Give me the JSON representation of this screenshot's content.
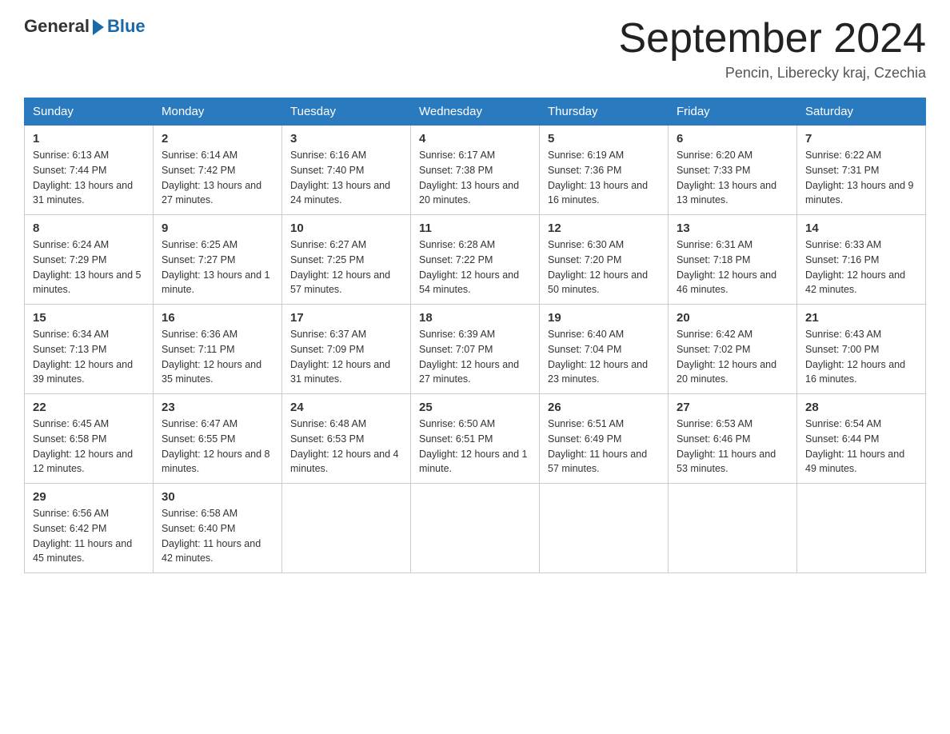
{
  "logo": {
    "text_general": "General",
    "text_blue": "Blue"
  },
  "title": "September 2024",
  "location": "Pencin, Liberecky kraj, Czechia",
  "days_of_week": [
    "Sunday",
    "Monday",
    "Tuesday",
    "Wednesday",
    "Thursday",
    "Friday",
    "Saturday"
  ],
  "weeks": [
    [
      {
        "day": "1",
        "info": "Sunrise: 6:13 AM\nSunset: 7:44 PM\nDaylight: 13 hours and 31 minutes."
      },
      {
        "day": "2",
        "info": "Sunrise: 6:14 AM\nSunset: 7:42 PM\nDaylight: 13 hours and 27 minutes."
      },
      {
        "day": "3",
        "info": "Sunrise: 6:16 AM\nSunset: 7:40 PM\nDaylight: 13 hours and 24 minutes."
      },
      {
        "day": "4",
        "info": "Sunrise: 6:17 AM\nSunset: 7:38 PM\nDaylight: 13 hours and 20 minutes."
      },
      {
        "day": "5",
        "info": "Sunrise: 6:19 AM\nSunset: 7:36 PM\nDaylight: 13 hours and 16 minutes."
      },
      {
        "day": "6",
        "info": "Sunrise: 6:20 AM\nSunset: 7:33 PM\nDaylight: 13 hours and 13 minutes."
      },
      {
        "day": "7",
        "info": "Sunrise: 6:22 AM\nSunset: 7:31 PM\nDaylight: 13 hours and 9 minutes."
      }
    ],
    [
      {
        "day": "8",
        "info": "Sunrise: 6:24 AM\nSunset: 7:29 PM\nDaylight: 13 hours and 5 minutes."
      },
      {
        "day": "9",
        "info": "Sunrise: 6:25 AM\nSunset: 7:27 PM\nDaylight: 13 hours and 1 minute."
      },
      {
        "day": "10",
        "info": "Sunrise: 6:27 AM\nSunset: 7:25 PM\nDaylight: 12 hours and 57 minutes."
      },
      {
        "day": "11",
        "info": "Sunrise: 6:28 AM\nSunset: 7:22 PM\nDaylight: 12 hours and 54 minutes."
      },
      {
        "day": "12",
        "info": "Sunrise: 6:30 AM\nSunset: 7:20 PM\nDaylight: 12 hours and 50 minutes."
      },
      {
        "day": "13",
        "info": "Sunrise: 6:31 AM\nSunset: 7:18 PM\nDaylight: 12 hours and 46 minutes."
      },
      {
        "day": "14",
        "info": "Sunrise: 6:33 AM\nSunset: 7:16 PM\nDaylight: 12 hours and 42 minutes."
      }
    ],
    [
      {
        "day": "15",
        "info": "Sunrise: 6:34 AM\nSunset: 7:13 PM\nDaylight: 12 hours and 39 minutes."
      },
      {
        "day": "16",
        "info": "Sunrise: 6:36 AM\nSunset: 7:11 PM\nDaylight: 12 hours and 35 minutes."
      },
      {
        "day": "17",
        "info": "Sunrise: 6:37 AM\nSunset: 7:09 PM\nDaylight: 12 hours and 31 minutes."
      },
      {
        "day": "18",
        "info": "Sunrise: 6:39 AM\nSunset: 7:07 PM\nDaylight: 12 hours and 27 minutes."
      },
      {
        "day": "19",
        "info": "Sunrise: 6:40 AM\nSunset: 7:04 PM\nDaylight: 12 hours and 23 minutes."
      },
      {
        "day": "20",
        "info": "Sunrise: 6:42 AM\nSunset: 7:02 PM\nDaylight: 12 hours and 20 minutes."
      },
      {
        "day": "21",
        "info": "Sunrise: 6:43 AM\nSunset: 7:00 PM\nDaylight: 12 hours and 16 minutes."
      }
    ],
    [
      {
        "day": "22",
        "info": "Sunrise: 6:45 AM\nSunset: 6:58 PM\nDaylight: 12 hours and 12 minutes."
      },
      {
        "day": "23",
        "info": "Sunrise: 6:47 AM\nSunset: 6:55 PM\nDaylight: 12 hours and 8 minutes."
      },
      {
        "day": "24",
        "info": "Sunrise: 6:48 AM\nSunset: 6:53 PM\nDaylight: 12 hours and 4 minutes."
      },
      {
        "day": "25",
        "info": "Sunrise: 6:50 AM\nSunset: 6:51 PM\nDaylight: 12 hours and 1 minute."
      },
      {
        "day": "26",
        "info": "Sunrise: 6:51 AM\nSunset: 6:49 PM\nDaylight: 11 hours and 57 minutes."
      },
      {
        "day": "27",
        "info": "Sunrise: 6:53 AM\nSunset: 6:46 PM\nDaylight: 11 hours and 53 minutes."
      },
      {
        "day": "28",
        "info": "Sunrise: 6:54 AM\nSunset: 6:44 PM\nDaylight: 11 hours and 49 minutes."
      }
    ],
    [
      {
        "day": "29",
        "info": "Sunrise: 6:56 AM\nSunset: 6:42 PM\nDaylight: 11 hours and 45 minutes."
      },
      {
        "day": "30",
        "info": "Sunrise: 6:58 AM\nSunset: 6:40 PM\nDaylight: 11 hours and 42 minutes."
      },
      {
        "day": "",
        "info": ""
      },
      {
        "day": "",
        "info": ""
      },
      {
        "day": "",
        "info": ""
      },
      {
        "day": "",
        "info": ""
      },
      {
        "day": "",
        "info": ""
      }
    ]
  ]
}
